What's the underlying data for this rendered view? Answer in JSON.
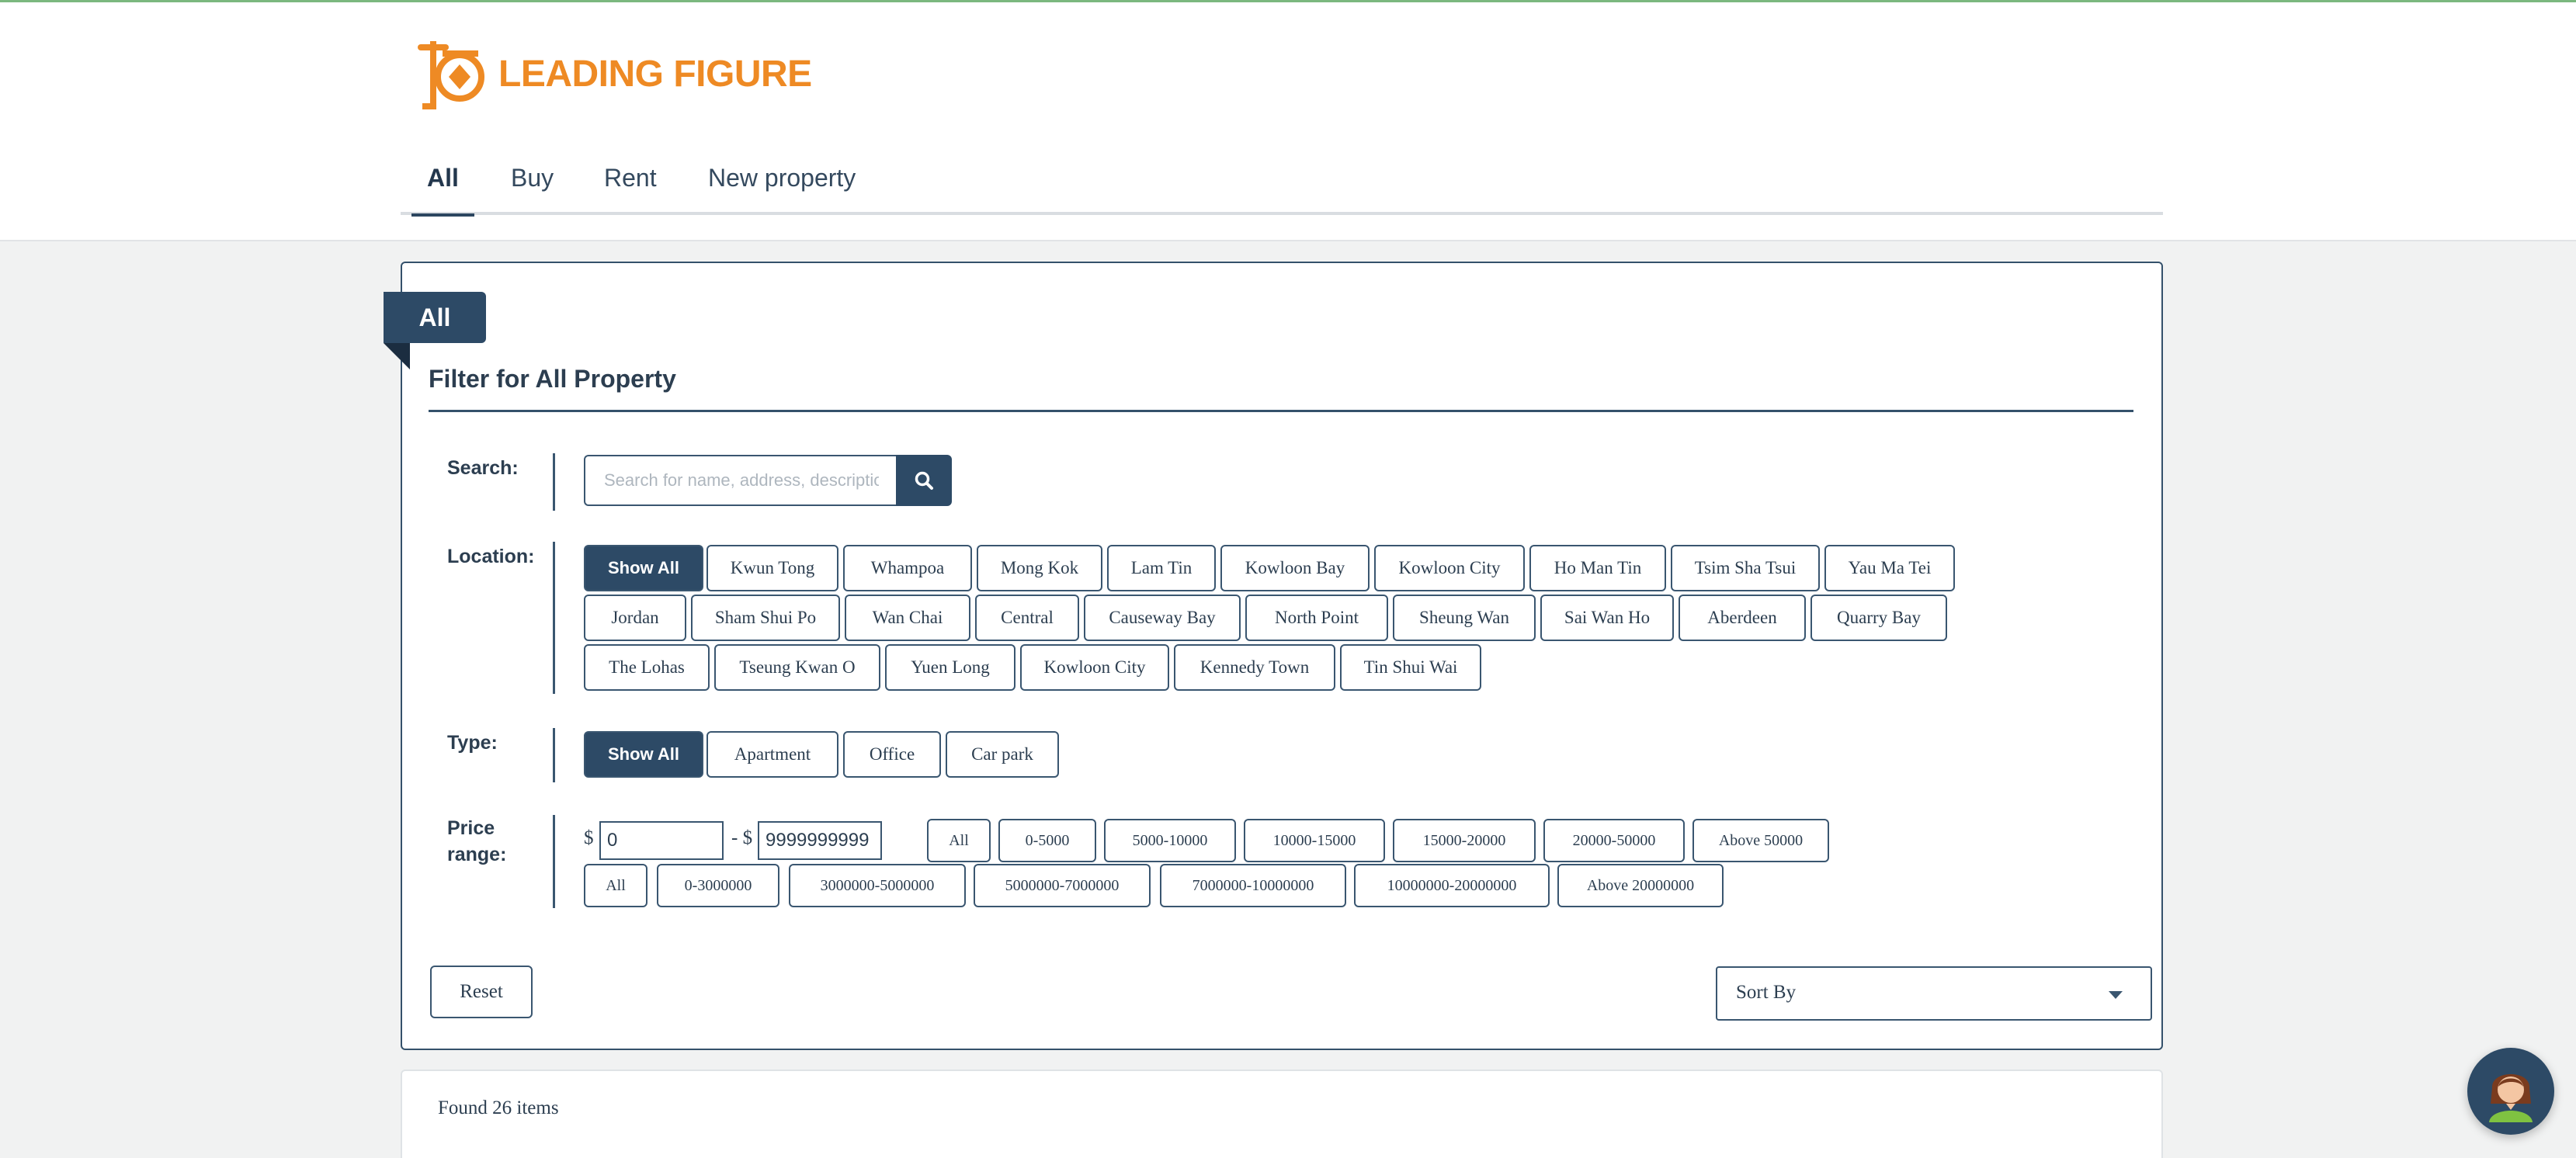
{
  "brand": {
    "name": "LEADING FIGURE",
    "color": "#ee8a24"
  },
  "nav": {
    "tabs": [
      {
        "label": "All",
        "active": true
      },
      {
        "label": "Buy",
        "active": false
      },
      {
        "label": "Rent",
        "active": false
      },
      {
        "label": "New property",
        "active": false
      }
    ]
  },
  "filter": {
    "badge": "All",
    "title": "Filter for All Property",
    "search": {
      "label": "Search:",
      "placeholder": "Search for name, address, description",
      "value": ""
    },
    "location": {
      "label": "Location:",
      "options": [
        "Show All",
        "Kwun Tong",
        "Whampoa",
        "Mong Kok",
        "Lam Tin",
        "Kowloon Bay",
        "Kowloon City",
        "Ho Man Tin",
        "Tsim Sha Tsui",
        "Yau Ma Tei",
        "Jordan",
        "Sham Shui Po",
        "Wan Chai",
        "Central",
        "Causeway Bay",
        "North Point",
        "Sheung Wan",
        "Sai Wan Ho",
        "Aberdeen",
        "Quarry Bay",
        "The Lohas",
        "Tseung Kwan O",
        "Yuen Long",
        "Kowloon City",
        "Kennedy Town",
        "Tin Shui Wai"
      ],
      "selected": "Show All"
    },
    "type": {
      "label": "Type:",
      "options": [
        "Show All",
        "Apartment",
        "Office",
        "Car park"
      ],
      "selected": "Show All"
    },
    "price": {
      "label": "Price range:",
      "currency": "$",
      "separator": "- $",
      "min": "0",
      "max": "9999999999",
      "rent_ranges": [
        "All",
        "0-5000",
        "5000-10000",
        "10000-15000",
        "15000-20000",
        "20000-50000",
        "Above 50000"
      ],
      "buy_ranges": [
        "All",
        "0-3000000",
        "3000000-5000000",
        "5000000-7000000",
        "7000000-10000000",
        "10000000-20000000",
        "Above 20000000"
      ]
    },
    "reset_label": "Reset",
    "sort_label": "Sort By"
  },
  "results": {
    "found_text": "Found 26 items"
  },
  "colors": {
    "primary": "#2d4a66",
    "accent": "#ee8a24",
    "background": "#f1f2f2"
  },
  "icons": {
    "search": "search-icon",
    "chat": "support-avatar-icon",
    "logo": "brand-logo-icon"
  }
}
